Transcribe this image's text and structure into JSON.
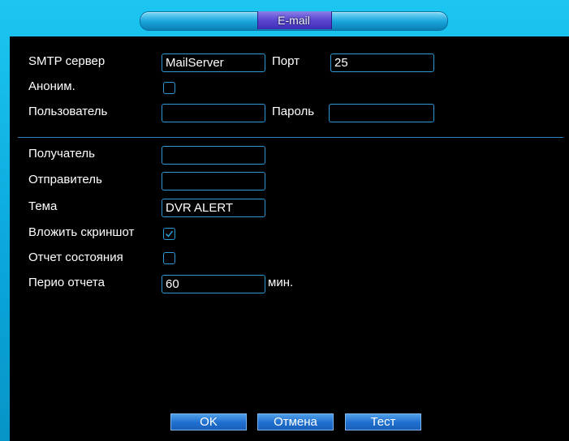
{
  "dialog": {
    "title": "E-mail"
  },
  "smtp": {
    "server_label": "SMTP сервер",
    "server_value": "MailServer",
    "port_label": "Порт",
    "port_value": "25"
  },
  "anon": {
    "label": "Аноним.",
    "checked": false
  },
  "auth": {
    "user_label": "Пользователь",
    "user_value": "",
    "password_label": "Пароль",
    "password_value": ""
  },
  "mail": {
    "recipient_label": "Получатель",
    "recipient_value": "",
    "sender_label": "Отправитель",
    "sender_value": "",
    "subject_label": "Тема",
    "subject_value": "DVR ALERT",
    "attach_label": "Вложить скриншот",
    "attach_checked": true,
    "status_label": "Отчет состояния",
    "status_checked": false,
    "period_label": "Перио отчета",
    "period_value": "60",
    "period_unit": "мин."
  },
  "buttons": {
    "ok": "OK",
    "cancel": "Отмена",
    "test": "Тест"
  },
  "colors": {
    "frame": "#07aee0",
    "panel": "#000000",
    "field_border": "#2f9ad6",
    "button": "#1f6fcf"
  }
}
